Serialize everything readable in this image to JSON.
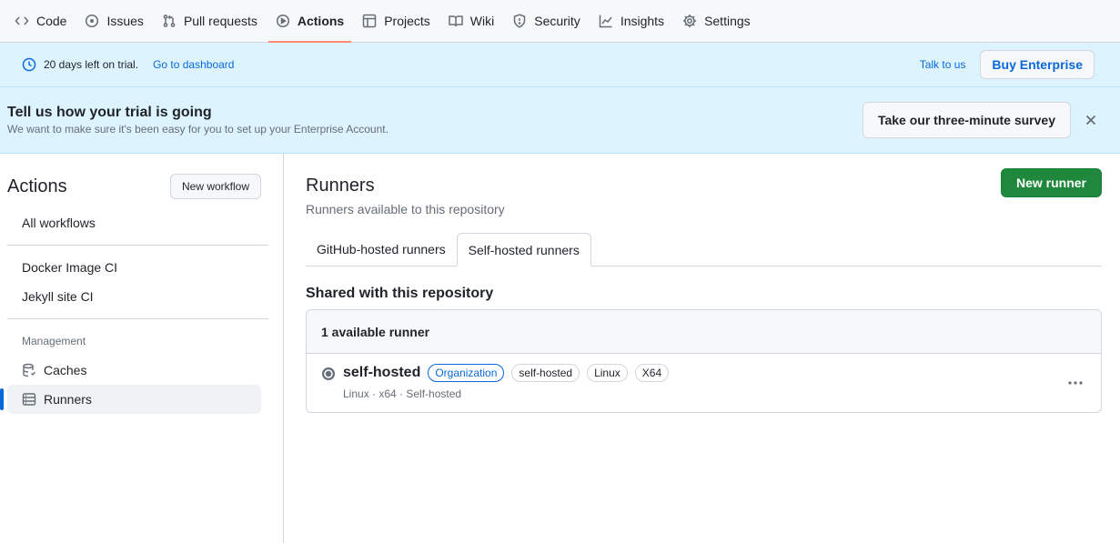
{
  "nav": {
    "items": [
      {
        "label": "Code",
        "icon": "code-icon"
      },
      {
        "label": "Issues",
        "icon": "issue-icon"
      },
      {
        "label": "Pull requests",
        "icon": "pull-request-icon"
      },
      {
        "label": "Actions",
        "icon": "play-icon",
        "active": true
      },
      {
        "label": "Projects",
        "icon": "table-icon"
      },
      {
        "label": "Wiki",
        "icon": "book-icon"
      },
      {
        "label": "Security",
        "icon": "shield-icon"
      },
      {
        "label": "Insights",
        "icon": "graph-icon"
      },
      {
        "label": "Settings",
        "icon": "gear-icon"
      }
    ]
  },
  "trial": {
    "days_left": "20 days left on trial.",
    "dashboard_link": "Go to dashboard",
    "talk_link": "Talk to us",
    "buy_button": "Buy Enterprise"
  },
  "survey": {
    "title": "Tell us how your trial is going",
    "subtitle": "We want to make sure it's been easy for you to set up your Enterprise Account.",
    "button": "Take our three-minute survey"
  },
  "sidebar": {
    "title": "Actions",
    "new_workflow": "New workflow",
    "all_workflows": "All workflows",
    "workflows": [
      "Docker Image CI",
      "Jekyll site CI"
    ],
    "section": "Management",
    "management": [
      {
        "label": "Caches",
        "icon": "database-icon"
      },
      {
        "label": "Runners",
        "icon": "server-icon",
        "active": true
      }
    ]
  },
  "main": {
    "title": "Runners",
    "subtitle": "Runners available to this repository",
    "new_runner": "New runner",
    "tabs": [
      {
        "label": "GitHub-hosted runners"
      },
      {
        "label": "Self-hosted runners",
        "selected": true
      }
    ],
    "shared_title": "Shared with this repository",
    "box_header": "1 available runner",
    "runner": {
      "name": "self-hosted",
      "labels": [
        "Organization",
        "self-hosted",
        "Linux",
        "X64"
      ],
      "meta": "Linux · x64 · Self-hosted"
    }
  },
  "colors": {
    "accent": "#0969da",
    "primary_button": "#1f883d",
    "active_tab_underline": "#fd8c73",
    "banner_bg": "#ddf4ff"
  }
}
